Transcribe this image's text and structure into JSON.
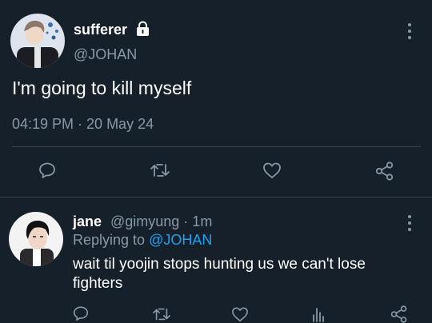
{
  "tweet": {
    "author_name": "sufferer",
    "author_handle": "@JOHAN",
    "text": "I'm going to kill myself",
    "timestamp": "04:19 PM · 20 May 24",
    "actions": [
      "reply-icon",
      "retweet-icon",
      "like-icon",
      "share-icon"
    ]
  },
  "reply": {
    "author_name": "jane",
    "author_handle": "@gimyung · 1m",
    "replying_prefix": "Replying to ",
    "replying_to": "@JOHAN",
    "text": "wait til yoojin stops hunting us we can't lose fighters",
    "actions": [
      "reply-icon",
      "retweet-icon",
      "like-icon",
      "analytics-icon",
      "share-icon"
    ]
  },
  "colors": {
    "background": "#15202b",
    "secondary_text": "#8899a6",
    "link": "#1da1f2",
    "divider": "#38444d"
  }
}
